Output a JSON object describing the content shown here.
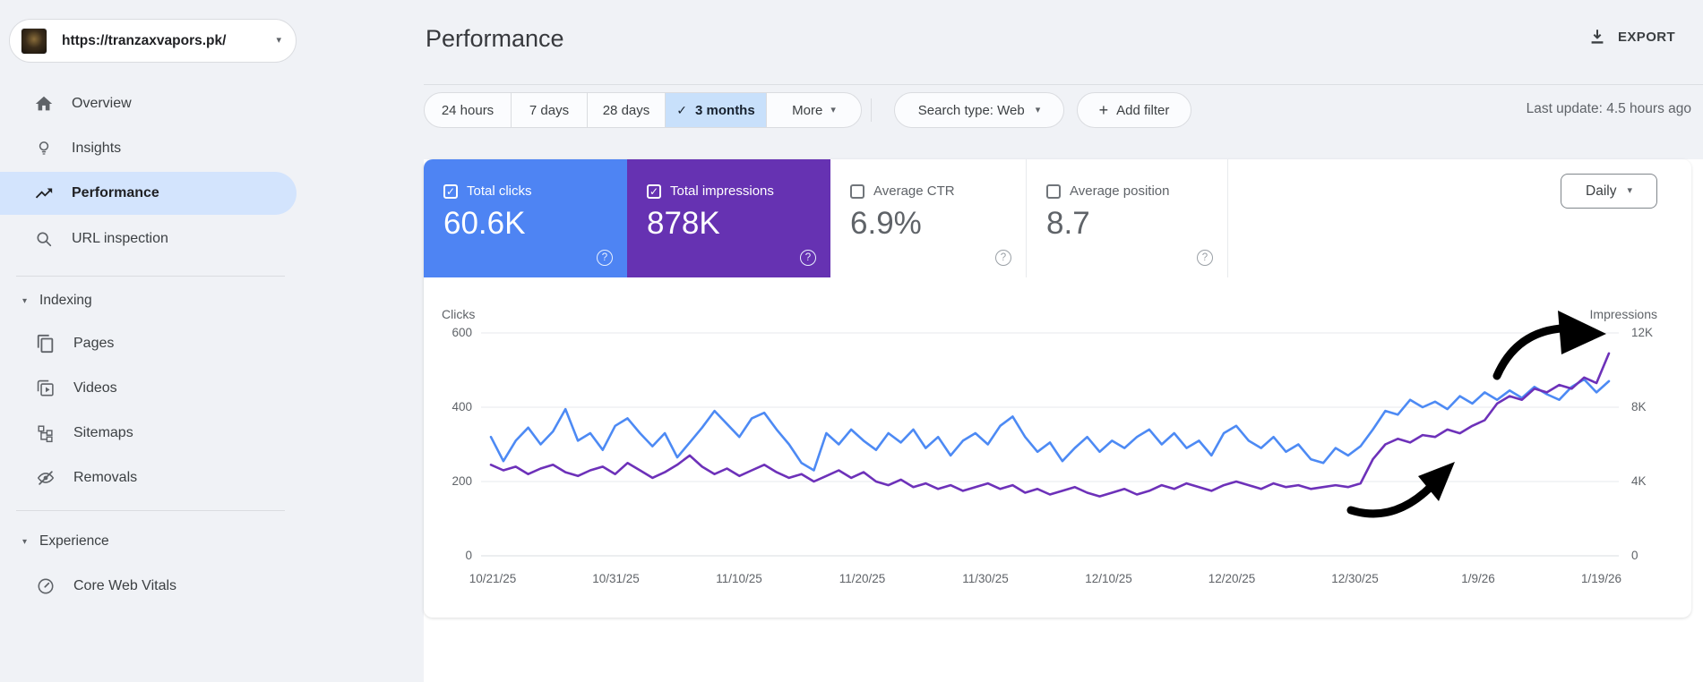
{
  "property": {
    "url": "https://tranzaxvapors.pk/"
  },
  "icons": {
    "check_icon": "✓",
    "chevron_down_icon": "▾",
    "caret_down_icon": "▾",
    "plus_icon": "+",
    "help_icon": "?"
  },
  "sidebar": {
    "items": [
      {
        "label": "Overview",
        "icon": "home-icon"
      },
      {
        "label": "Insights",
        "icon": "lightbulb-icon"
      },
      {
        "label": "Performance",
        "icon": "trending-up-icon",
        "selected": true
      },
      {
        "label": "URL inspection",
        "icon": "search-icon"
      }
    ],
    "sections": [
      {
        "label": "Indexing",
        "items": [
          {
            "label": "Pages",
            "icon": "pages-icon"
          },
          {
            "label": "Videos",
            "icon": "video-icon"
          },
          {
            "label": "Sitemaps",
            "icon": "sitemap-icon"
          },
          {
            "label": "Removals",
            "icon": "eye-off-icon"
          }
        ]
      },
      {
        "label": "Experience",
        "items": [
          {
            "label": "Core Web Vitals",
            "icon": "gauge-icon"
          }
        ]
      }
    ]
  },
  "header": {
    "title": "Performance",
    "export_label": "EXPORT"
  },
  "filters": {
    "date_ranges": [
      "24 hours",
      "7 days",
      "28 days",
      "3 months",
      "More"
    ],
    "selected_range": "3 months",
    "search_type": "Search type: Web",
    "add_filter_label": "Add filter",
    "last_update": "Last update: 4.5 hours ago"
  },
  "metrics": {
    "granularity": "Daily",
    "cards": [
      {
        "label": "Total clicks",
        "value": "60.6K",
        "checked": true,
        "color": "#4e84f3"
      },
      {
        "label": "Total impressions",
        "value": "878K",
        "checked": true,
        "color": "#6632b2"
      },
      {
        "label": "Average CTR",
        "value": "6.9%",
        "checked": false,
        "color": "#ffffff"
      },
      {
        "label": "Average position",
        "value": "8.7",
        "checked": false,
        "color": "#ffffff"
      }
    ]
  },
  "chart_data": {
    "type": "line",
    "title": "Clicks and impressions over time (3 months, daily)",
    "grid": true,
    "left_axis": {
      "label": "Clicks",
      "ticks": [
        "600",
        "400",
        "200",
        "0"
      ],
      "range": [
        0,
        600
      ]
    },
    "right_axis": {
      "label": "Impressions",
      "ticks": [
        "12K",
        "8K",
        "4K",
        "0"
      ],
      "range": [
        0,
        12
      ],
      "unit": "K"
    },
    "x_tick_labels": [
      "10/21/25",
      "10/31/25",
      "11/10/25",
      "11/20/25",
      "11/30/25",
      "12/10/25",
      "12/20/25",
      "12/30/25",
      "1/9/26",
      "1/19/26"
    ],
    "series": [
      {
        "name": "Clicks",
        "axis": "left",
        "color": "#4d8af4",
        "values": [
          320,
          255,
          310,
          345,
          300,
          335,
          395,
          310,
          330,
          285,
          350,
          370,
          330,
          295,
          330,
          265,
          305,
          345,
          390,
          355,
          320,
          370,
          385,
          340,
          300,
          250,
          230,
          330,
          300,
          340,
          310,
          285,
          330,
          305,
          340,
          290,
          320,
          270,
          310,
          330,
          300,
          350,
          375,
          320,
          280,
          305,
          255,
          290,
          320,
          280,
          310,
          290,
          320,
          340,
          300,
          330,
          290,
          310,
          270,
          330,
          350,
          310,
          290,
          320,
          280,
          300,
          260,
          250,
          290,
          270,
          295,
          340,
          390,
          380,
          420,
          400,
          415,
          395,
          430,
          410,
          440,
          420,
          445,
          425,
          455,
          435,
          420,
          455,
          475,
          440,
          470
        ]
      },
      {
        "name": "Impressions",
        "axis": "right",
        "unit": "K",
        "color": "#6d31b9",
        "values": [
          4.9,
          4.6,
          4.8,
          4.4,
          4.7,
          4.9,
          4.5,
          4.3,
          4.6,
          4.8,
          4.4,
          5.0,
          4.6,
          4.2,
          4.5,
          4.9,
          5.4,
          4.8,
          4.4,
          4.7,
          4.3,
          4.6,
          4.9,
          4.5,
          4.2,
          4.4,
          4.0,
          4.3,
          4.6,
          4.2,
          4.5,
          4.0,
          3.8,
          4.1,
          3.7,
          3.9,
          3.6,
          3.8,
          3.5,
          3.7,
          3.9,
          3.6,
          3.8,
          3.4,
          3.6,
          3.3,
          3.5,
          3.7,
          3.4,
          3.2,
          3.4,
          3.6,
          3.3,
          3.5,
          3.8,
          3.6,
          3.9,
          3.7,
          3.5,
          3.8,
          4.0,
          3.8,
          3.6,
          3.9,
          3.7,
          3.8,
          3.6,
          3.7,
          3.8,
          3.7,
          3.9,
          5.2,
          6.0,
          6.3,
          6.1,
          6.5,
          6.4,
          6.8,
          6.6,
          7.0,
          7.3,
          8.2,
          8.6,
          8.4,
          9.0,
          8.8,
          9.2,
          9.0,
          9.6,
          9.3,
          10.9
        ]
      }
    ],
    "annotations": [
      "hand-drawn black arrow pointing at rising impressions line (top right)",
      "hand-drawn black arrow pointing at rising trend (center right)"
    ]
  }
}
